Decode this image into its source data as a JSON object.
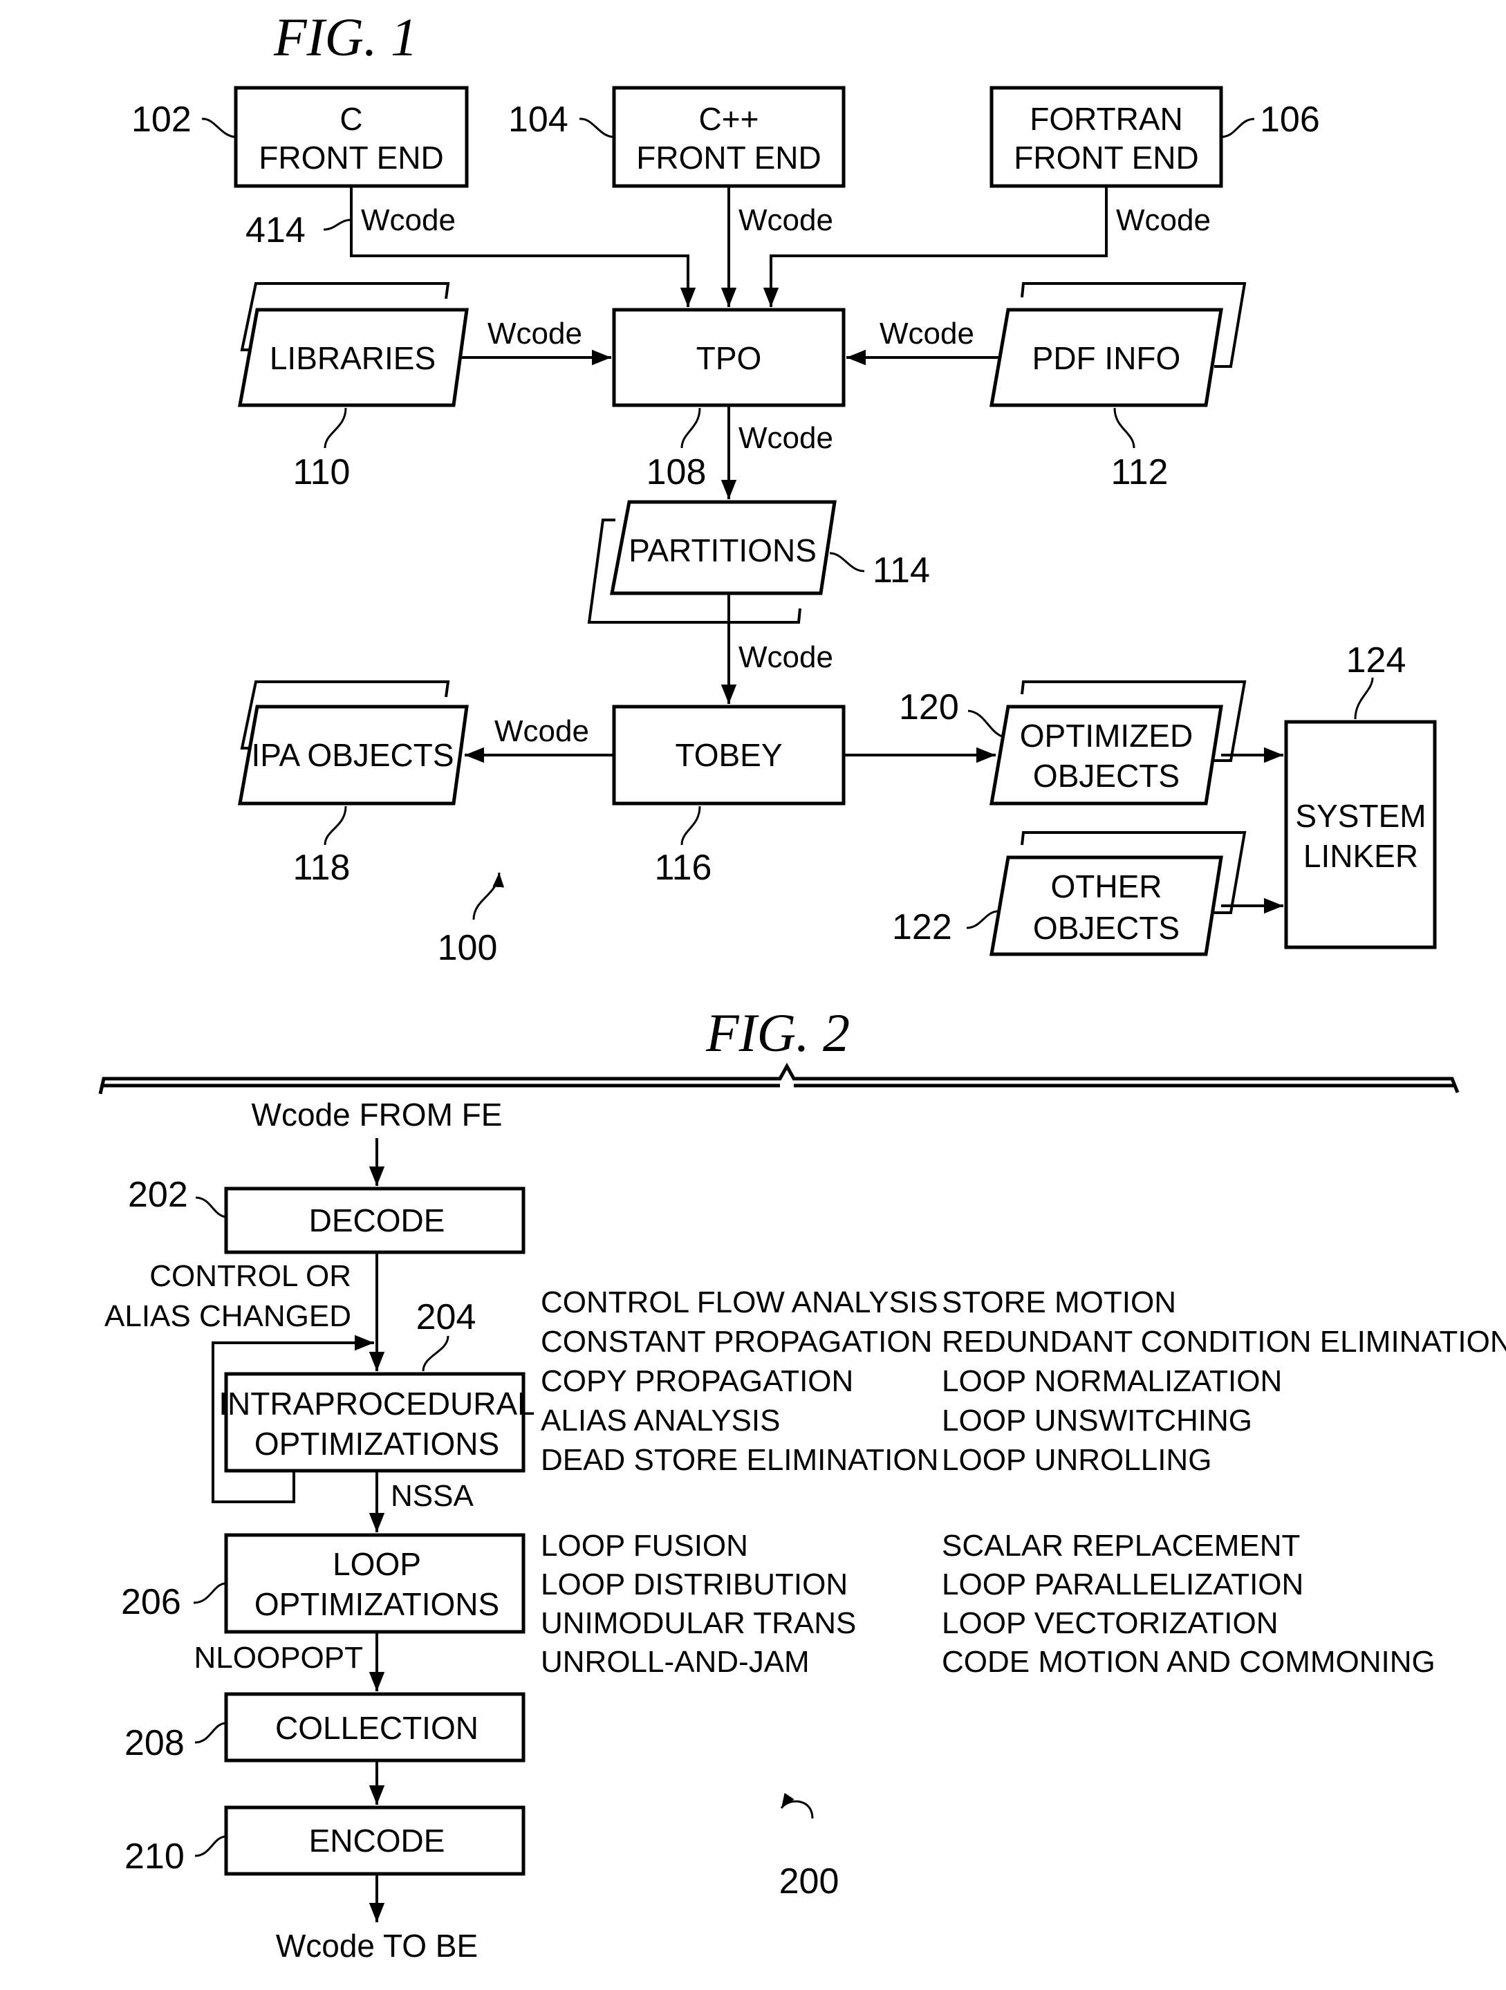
{
  "fig1": {
    "title": "FIG. 1",
    "ref": "100",
    "nodes": {
      "c_front_end": {
        "line1": "C",
        "line2": "FRONT END",
        "ref": "102"
      },
      "cpp_front_end": {
        "line1": "C++",
        "line2": "FRONT END",
        "ref": "104"
      },
      "fortran_front_end": {
        "line1": "FORTRAN",
        "line2": "FRONT END",
        "ref": "106"
      },
      "tpo": {
        "label": "TPO",
        "ref": "108"
      },
      "libraries": {
        "label": "LIBRARIES",
        "ref": "110"
      },
      "pdf_info": {
        "label": "PDF INFO",
        "ref": "112"
      },
      "partitions": {
        "label": "PARTITIONS",
        "ref": "114"
      },
      "tobey": {
        "label": "TOBEY",
        "ref": "116"
      },
      "ipa_objects": {
        "label": "IPA OBJECTS",
        "ref": "118"
      },
      "optimized_objects": {
        "line1": "OPTIMIZED",
        "line2": "OBJECTS",
        "ref": "120"
      },
      "other_objects": {
        "line1": "OTHER",
        "line2": "OBJECTS",
        "ref": "122"
      },
      "system_linker": {
        "line1": "SYSTEM",
        "line2": "LINKER",
        "ref": "124"
      }
    },
    "edges": {
      "c_to_tpo": {
        "label": "Wcode",
        "ref": "414"
      },
      "cpp_to_tpo": {
        "label": "Wcode"
      },
      "fortran_to_tpo": {
        "label": "Wcode"
      },
      "libraries_to_tpo": {
        "label": "Wcode"
      },
      "pdf_to_tpo": {
        "label": "Wcode"
      },
      "tpo_to_partitions": {
        "label": "Wcode"
      },
      "partitions_to_tobey": {
        "label": "Wcode"
      },
      "tobey_to_ipa": {
        "label": "Wcode"
      }
    }
  },
  "fig2": {
    "title": "FIG. 2",
    "ref": "200",
    "input_label": "Wcode FROM FE",
    "output_label": "Wcode TO BE",
    "nodes": {
      "decode": {
        "label": "DECODE",
        "ref": "202"
      },
      "intraprocedural": {
        "line1": "INTRAPROCEDURAL",
        "line2": "OPTIMIZATIONS",
        "ref": "204"
      },
      "loop_opt": {
        "line1": "LOOP",
        "line2": "OPTIMIZATIONS",
        "ref": "206"
      },
      "collection": {
        "label": "COLLECTION",
        "ref": "208"
      },
      "encode": {
        "label": "ENCODE",
        "ref": "210"
      }
    },
    "edges": {
      "feedback": {
        "line1": "CONTROL OR",
        "line2": "ALIAS CHANGED"
      },
      "intra_to_loop": {
        "label": "NSSA"
      },
      "loop_to_collection": {
        "label": "NLOOPOPT"
      }
    },
    "intraprocedural_list": {
      "col1": [
        "CONTROL FLOW ANALYSIS",
        "CONSTANT PROPAGATION",
        "COPY PROPAGATION",
        "ALIAS ANALYSIS",
        "DEAD STORE ELIMINATION"
      ],
      "col2": [
        "STORE MOTION",
        "REDUNDANT CONDITION ELIMINATION",
        "LOOP NORMALIZATION",
        "LOOP UNSWITCHING",
        "LOOP UNROLLING"
      ]
    },
    "loop_list": {
      "col1": [
        "LOOP FUSION",
        "LOOP DISTRIBUTION",
        "UNIMODULAR TRANS",
        "UNROLL-AND-JAM"
      ],
      "col2": [
        "SCALAR REPLACEMENT",
        "LOOP PARALLELIZATION",
        "LOOP VECTORIZATION",
        "CODE MOTION AND COMMONING"
      ]
    }
  }
}
